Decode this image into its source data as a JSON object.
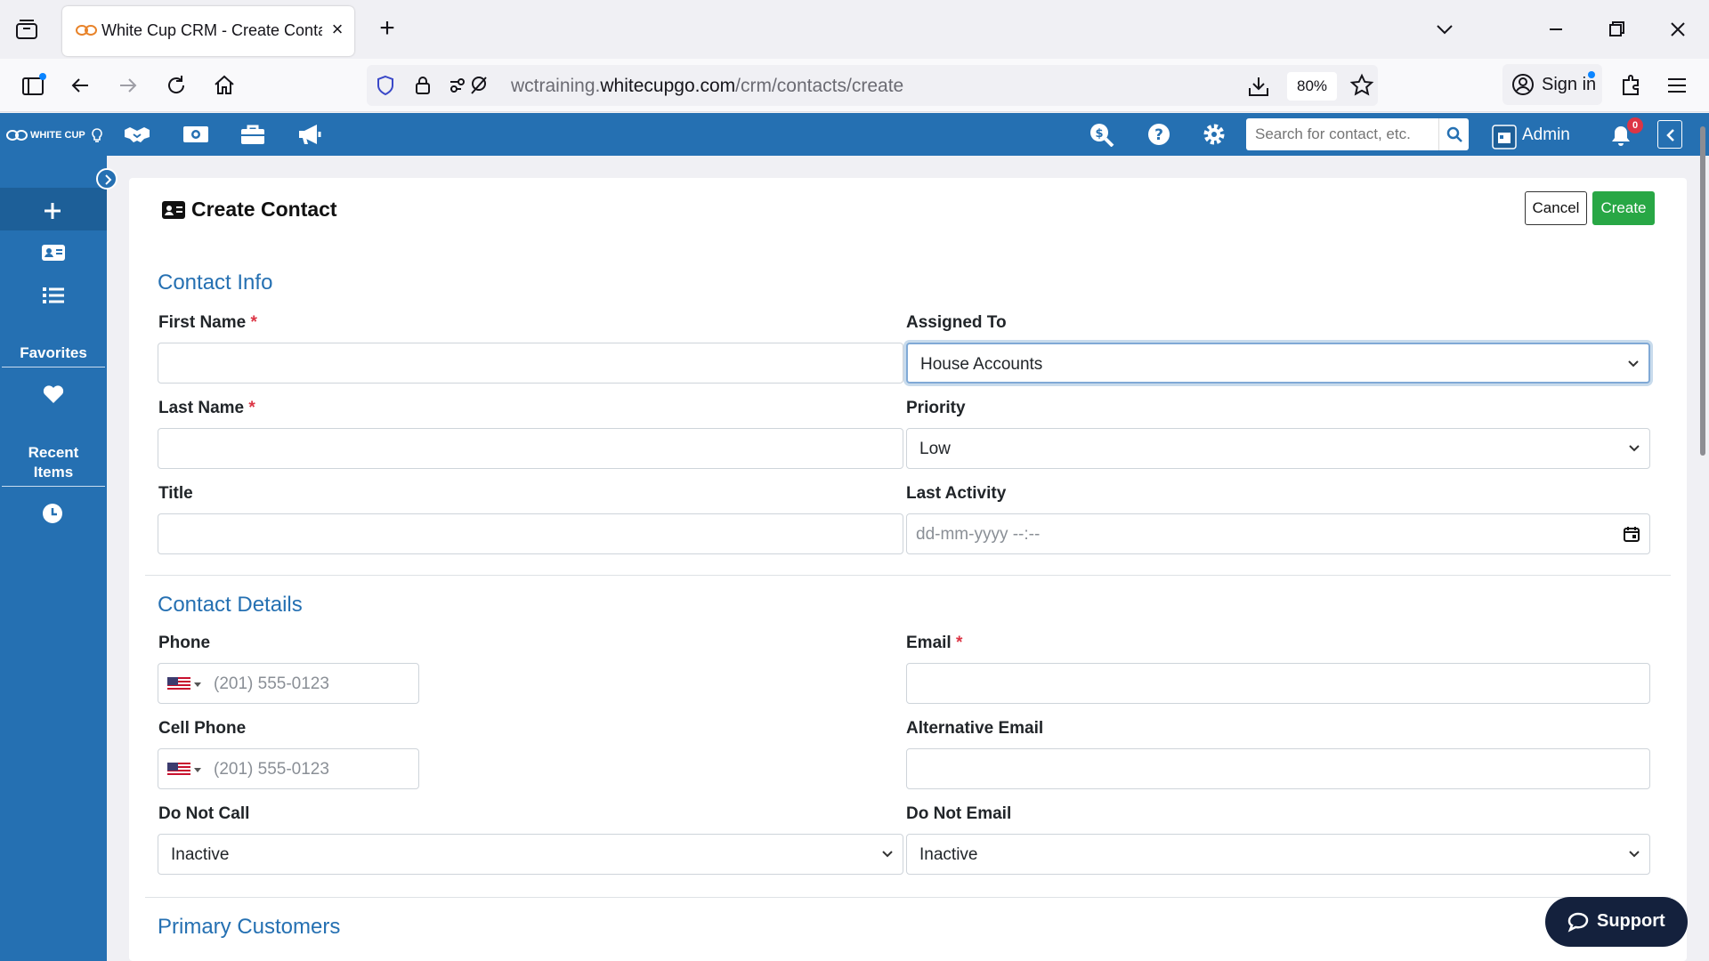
{
  "browser": {
    "tab_title": "White Cup CRM - Create Contact",
    "url_prefix": "wctraining.",
    "url_host": "whitecupgo.com",
    "url_path": "/crm/contacts/create",
    "zoom": "80%",
    "signin_label": "Sign in"
  },
  "app": {
    "logo_text": "WHITE CUP",
    "search_placeholder": "Search for contact, etc.",
    "user_label": "Admin",
    "notification_count": "0"
  },
  "sidebar": {
    "favorites_label": "Favorites",
    "recent_label_line1": "Recent",
    "recent_label_line2": "Items"
  },
  "page": {
    "title": "Create Contact",
    "cancel_label": "Cancel",
    "create_label": "Create"
  },
  "sections": {
    "contact_info": "Contact Info",
    "contact_details": "Contact Details",
    "primary_customers": "Primary Customers"
  },
  "fields": {
    "first_name": {
      "label": "First Name",
      "required": "*",
      "value": ""
    },
    "last_name": {
      "label": "Last Name",
      "required": "*",
      "value": ""
    },
    "title": {
      "label": "Title",
      "value": ""
    },
    "assigned_to": {
      "label": "Assigned To",
      "value": "House Accounts"
    },
    "priority": {
      "label": "Priority",
      "value": "Low"
    },
    "last_activity": {
      "label": "Last Activity",
      "placeholder": "dd-mm-yyyy --:--"
    },
    "phone": {
      "label": "Phone",
      "placeholder": "(201) 555-0123"
    },
    "cell_phone": {
      "label": "Cell Phone",
      "placeholder": "(201) 555-0123"
    },
    "email": {
      "label": "Email",
      "required": "*",
      "value": ""
    },
    "alt_email": {
      "label": "Alternative Email",
      "value": ""
    },
    "do_not_call": {
      "label": "Do Not Call",
      "value": "Inactive"
    },
    "do_not_email": {
      "label": "Do Not Email",
      "value": "Inactive"
    }
  },
  "support": {
    "label": "Support"
  },
  "colors": {
    "brand_blue": "#2570b2",
    "create_green": "#28a745",
    "required_red": "#dc3545",
    "support_navy": "#14213d"
  }
}
